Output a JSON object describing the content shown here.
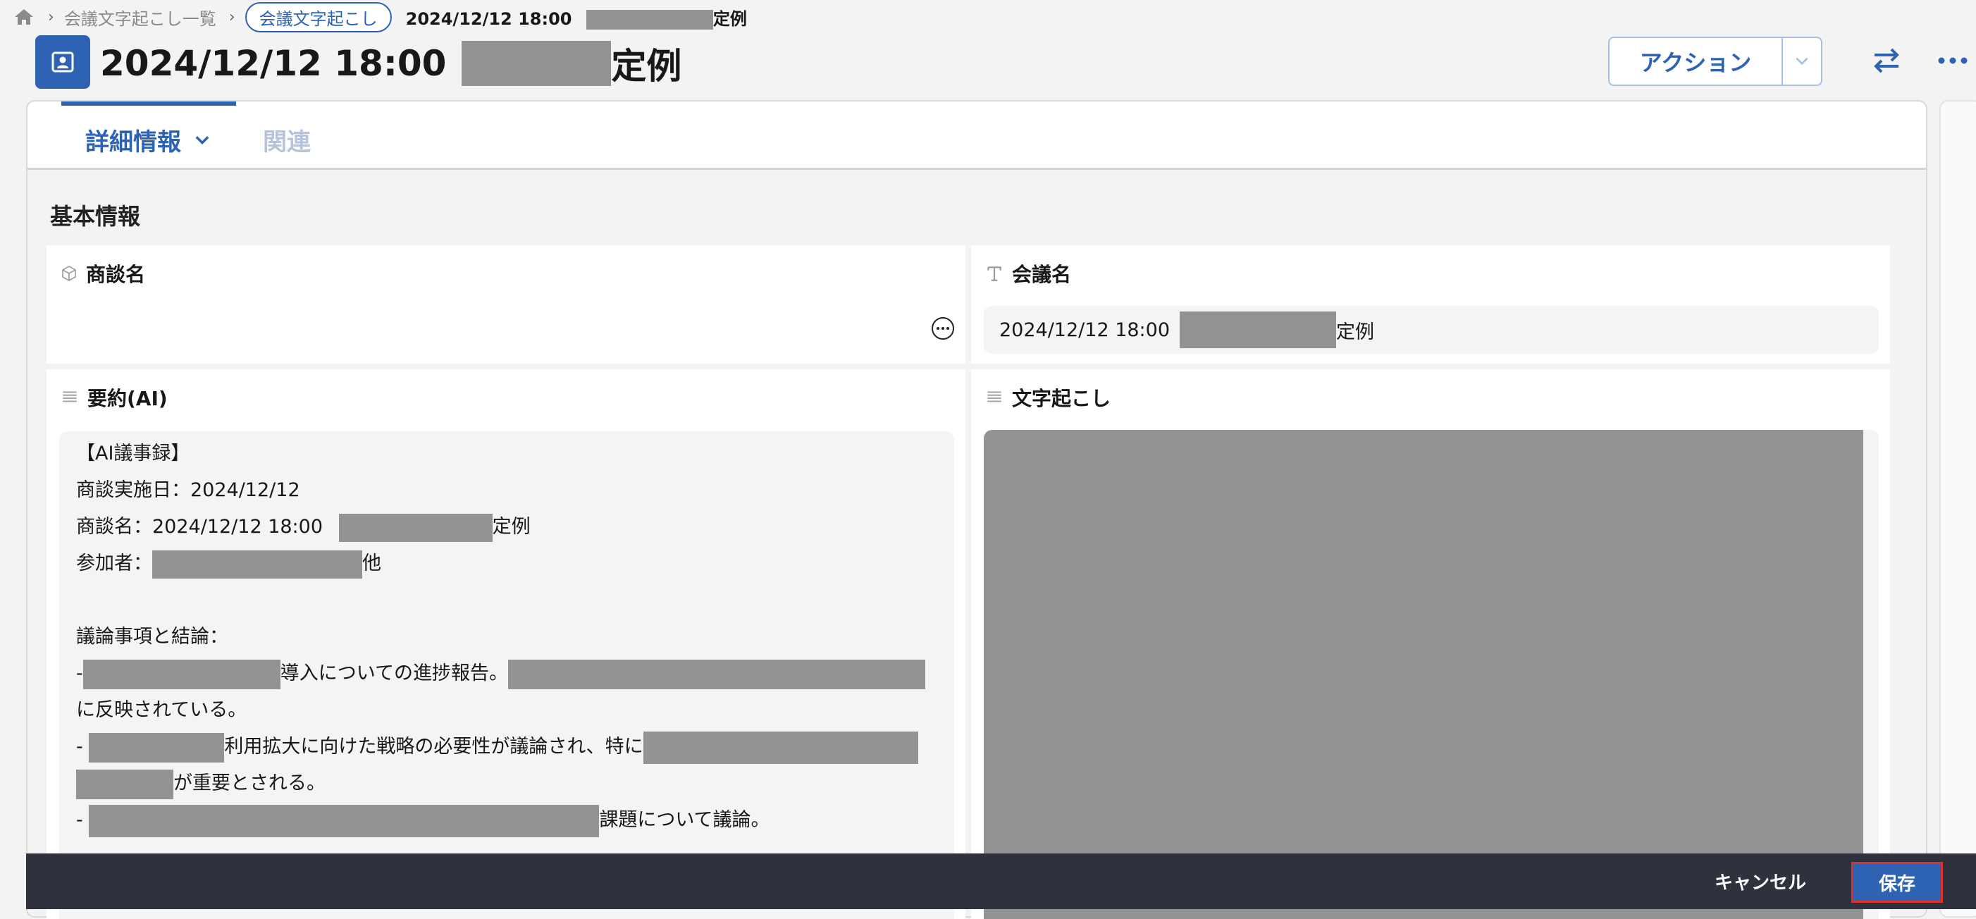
{
  "breadcrumb": {
    "home_icon": "home-icon",
    "list_label": "会議文字起こし一覧",
    "object_label": "会議文字起こし",
    "current_title_prefix": "2024/12/12 18:00",
    "current_title_suffix": "定例"
  },
  "header": {
    "icon": "contact-card-icon",
    "title_prefix": "2024/12/12 18:00",
    "title_suffix": "定例",
    "action_label": "アクション",
    "swap_icon": "swap-arrows-icon",
    "more_icon": "more-horizontal-icon"
  },
  "tabs": [
    {
      "label": "詳細情報",
      "active": true
    },
    {
      "label": "関連",
      "active": false
    }
  ],
  "section": {
    "title": "基本情報"
  },
  "fields": {
    "deal": {
      "label": "商談名",
      "icon": "cube-icon",
      "value": ""
    },
    "meeting": {
      "label": "会議名",
      "icon": "text-type-icon",
      "value_prefix": "2024/12/12 18:00",
      "value_suffix": "定例"
    },
    "summary": {
      "label": "要約(AI)",
      "icon": "long-text-icon",
      "lines": {
        "heading": "【AI議事録】",
        "date": "商談実施日：2024/12/12",
        "deal_prefix": "商談名：2024/12/12 18:00",
        "deal_suffix": "定例",
        "participants_prefix": "参加者：",
        "participants_suffix": "他",
        "topics_heading": "議論事項と結論：",
        "item1_a": "導入についての進捗報告。",
        "item1_b": "に反映されている。",
        "item2_a": "利用拡大に向けた戦略の必要性が議論され、特に",
        "item2_b": "が重要とされる。",
        "item3_a": "課題について議論。",
        "dash": "-"
      }
    },
    "transcript": {
      "label": "文字起こし",
      "icon": "long-text-icon"
    }
  },
  "footer": {
    "cancel_label": "キャンセル",
    "save_label": "保存"
  },
  "colors": {
    "brand": "#2e63b3",
    "footer_bg": "#2f323c",
    "highlight": "#e0322c",
    "redaction": "#939393"
  }
}
